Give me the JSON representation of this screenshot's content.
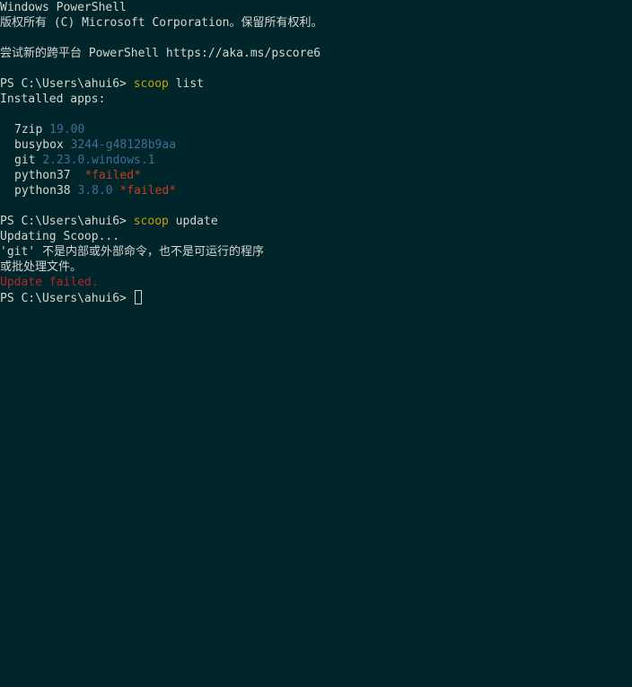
{
  "header": {
    "line1": "Windows PowerShell",
    "line2": "版权所有 (C) Microsoft Corporation。保留所有权利。",
    "line3": "尝试新的跨平台 PowerShell https://aka.ms/pscore6"
  },
  "prompt1": {
    "prefix": "PS C:\\Users\\ahui6> ",
    "command": "scoop",
    "args": " list"
  },
  "list_output": {
    "heading": "Installed apps:",
    "apps": [
      {
        "name": "7zip",
        "sep": " ",
        "version": "19.00"
      },
      {
        "name": "busybox",
        "sep": " ",
        "version": "3244-g48128b9aa"
      },
      {
        "name": "git",
        "sep": " ",
        "version": "2.23.0.windows.1"
      },
      {
        "name": "python37",
        "sep": "  ",
        "status": "*failed*"
      },
      {
        "name": "python38",
        "sep": " ",
        "version": "3.8.0",
        "status": "*failed*"
      }
    ]
  },
  "prompt2": {
    "prefix": "PS C:\\Users\\ahui6> ",
    "command": "scoop",
    "args": " update"
  },
  "update_output": {
    "line1": "Updating Scoop...",
    "line2": "'git' 不是内部或外部命令，也不是可运行的程序",
    "line3": "或批处理文件。",
    "error": "Update failed."
  },
  "prompt3": {
    "prefix": "PS C:\\Users\\ahui6> "
  },
  "colors": {
    "background": "#00252b",
    "text": "#d3d7cf",
    "command": "#c4a000",
    "version": "#3e6f95",
    "failed": "#c1401a",
    "error": "#b0262b"
  }
}
